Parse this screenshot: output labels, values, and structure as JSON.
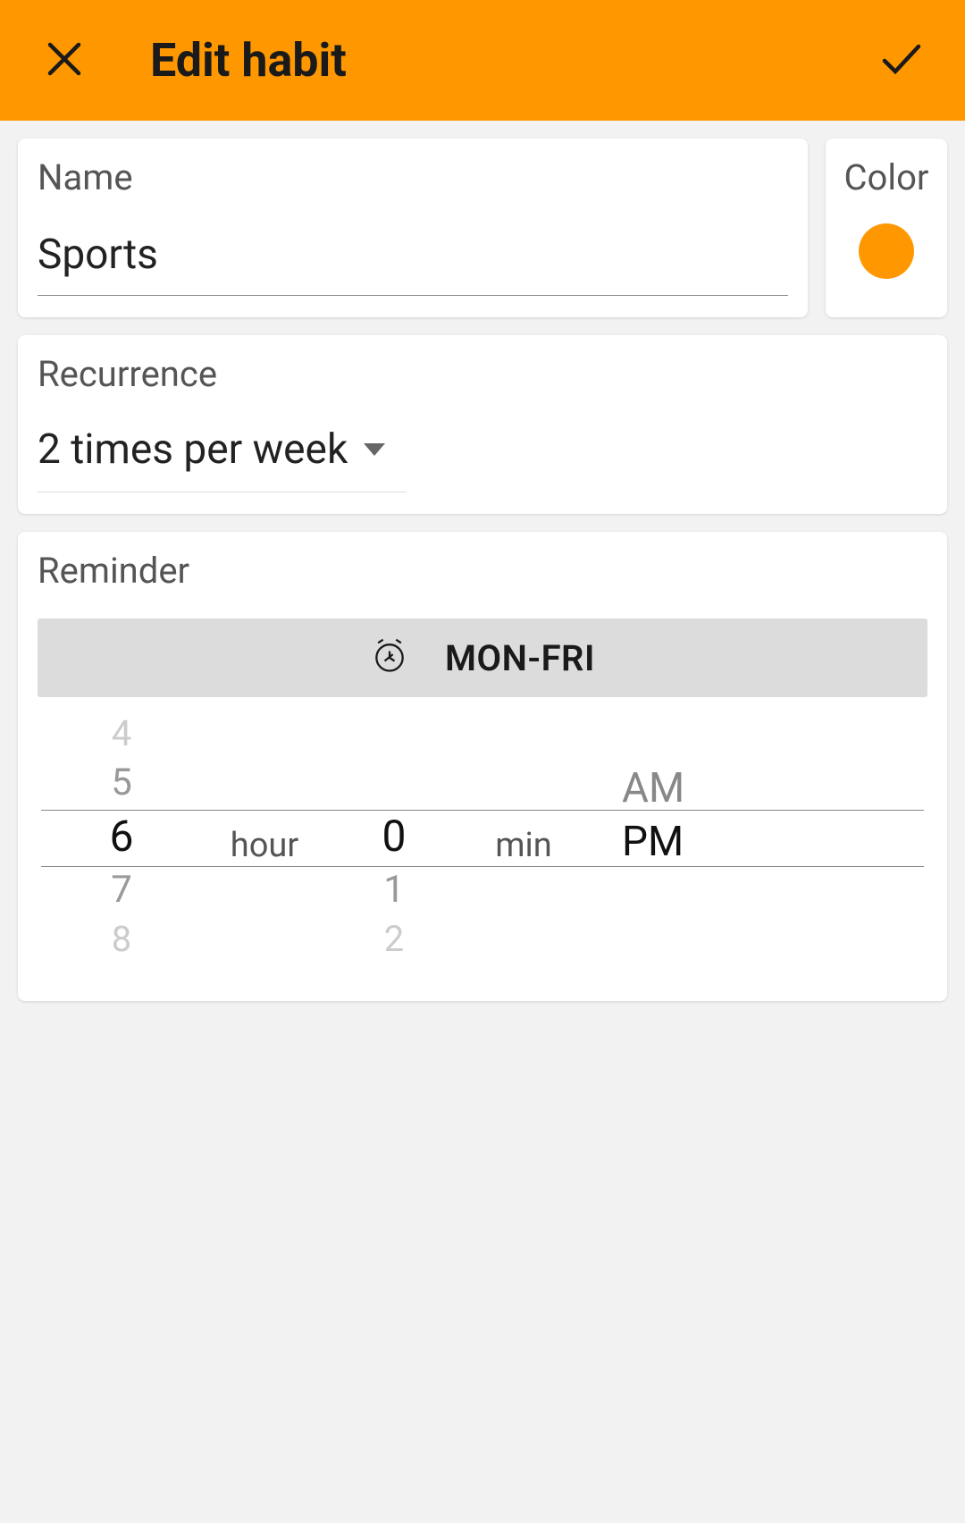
{
  "header": {
    "title": "Edit habit"
  },
  "name_field": {
    "label": "Name",
    "value": "Sports"
  },
  "color_field": {
    "label": "Color",
    "swatch": "#ff9800"
  },
  "recurrence": {
    "label": "Recurrence",
    "value": "2 times per week"
  },
  "reminder": {
    "label": "Reminder",
    "days": "MON-FRI",
    "hour": {
      "label": "hour",
      "items": [
        "4",
        "5",
        "6",
        "7",
        "8"
      ],
      "selected_index": 2
    },
    "minute": {
      "label": "min",
      "items": [
        "0",
        "1",
        "2"
      ],
      "selected_index": 0
    },
    "ampm": {
      "items": [
        "AM",
        "PM"
      ],
      "selected_index": 1
    }
  }
}
